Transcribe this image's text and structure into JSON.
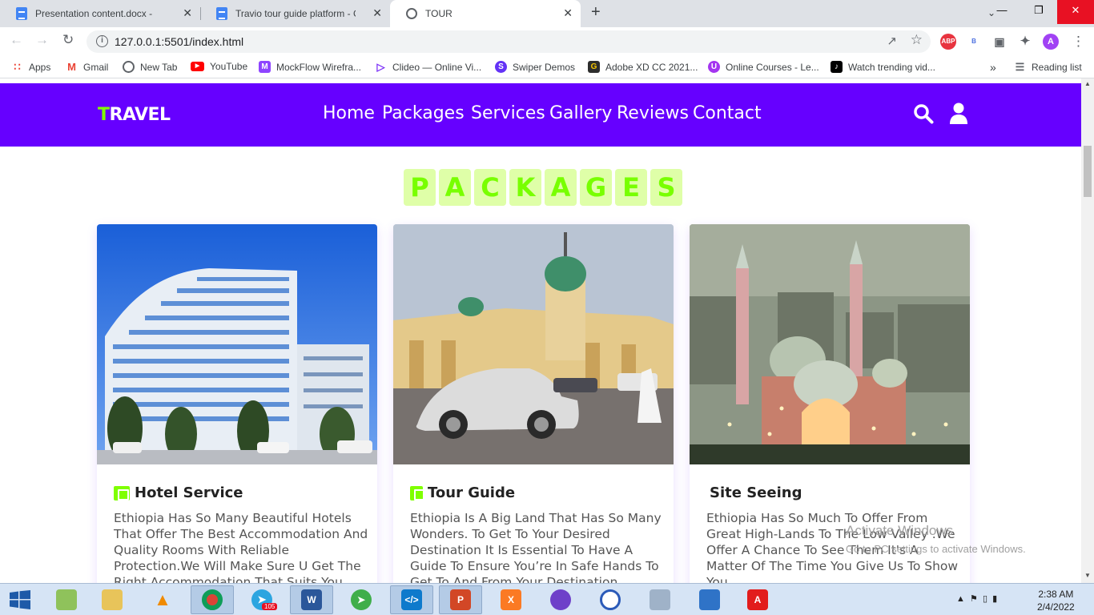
{
  "browser": {
    "tabs": [
      {
        "title": "Presentation content.docx - Goo",
        "active": false,
        "icon": "google-docs-icon"
      },
      {
        "title": "Travio tour guide platform - Goo",
        "active": false,
        "icon": "google-docs-icon"
      },
      {
        "title": "TOUR",
        "active": true,
        "icon": "globe-icon"
      }
    ],
    "close_glyph": "✕",
    "new_tab_glyph": "+",
    "url": "127.0.0.1:5501/index.html",
    "profile_initial": "A",
    "ext_abp": "ABP",
    "ext_b": "B"
  },
  "bookmarks": {
    "items": [
      {
        "label": "Apps",
        "icon": "apps-grid-icon",
        "color": "#ea4335"
      },
      {
        "label": "Gmail",
        "icon": "gmail-icon",
        "color": "#ea4335"
      },
      {
        "label": "New Tab",
        "icon": "globe-icon",
        "color": "#5f6368"
      },
      {
        "label": "YouTube",
        "icon": "youtube-icon",
        "color": "#ff0000"
      },
      {
        "label": "MockFlow Wirefra...",
        "icon": "mockflow-icon",
        "color": "#8e44ff"
      },
      {
        "label": "Clideo — Online Vi...",
        "icon": "clideo-icon",
        "color": "#7b2ff7"
      },
      {
        "label": "Swiper Demos",
        "icon": "swiper-icon",
        "color": "#6332f6"
      },
      {
        "label": "Adobe XD CC 2021...",
        "icon": "g-icon",
        "color": "#2d2d2d"
      },
      {
        "label": "Online Courses - Le...",
        "icon": "udemy-icon",
        "color": "#a435f0"
      },
      {
        "label": "Watch trending vid...",
        "icon": "tiktok-icon",
        "color": "#000000"
      }
    ],
    "overflow": "»",
    "reading_list": "Reading list"
  },
  "site": {
    "logo_first": "T",
    "logo_rest": "RAVEL",
    "nav": [
      "Home",
      "Packages",
      "Services",
      "Gallery",
      "Reviews",
      "Contact"
    ],
    "heading_letters": [
      "P",
      "A",
      "C",
      "K",
      "A",
      "G",
      "E",
      "S"
    ],
    "cards": [
      {
        "title": "Hotel Service",
        "icon": "hotel-icon",
        "text": "Ethiopia Has So Many Beautiful Hotels That Offer The Best Accommodation And Quality Rooms With Reliable Protection.We Will Make Sure U Get The Right Accommodation That Suits You."
      },
      {
        "title": "Tour Guide",
        "icon": "guide-icon",
        "text": "Ethiopia Is A Big Land That Has So Many Wonders. To Get To Your Desired Destination It Is Essential To Have A Guide To Ensure You’re In Safe Hands To Get To And From Your Destination."
      },
      {
        "title": "Site Seeing",
        "icon": "",
        "text": "Ethiopia Has So Much To Offer From Great High-Lands To The Low Valley .We Offer A Chance To See Them It's A Matter Of The Time You Give Us To Show You"
      }
    ],
    "accent": "#6600ff",
    "highlight": "#7fff00"
  },
  "watermark": {
    "title": "Activate Windows",
    "subtitle": "Go to PC settings to activate Windows."
  },
  "taskbar": {
    "clock_time": "2:38 AM",
    "clock_date": "2/4/2022",
    "badge": "105"
  }
}
